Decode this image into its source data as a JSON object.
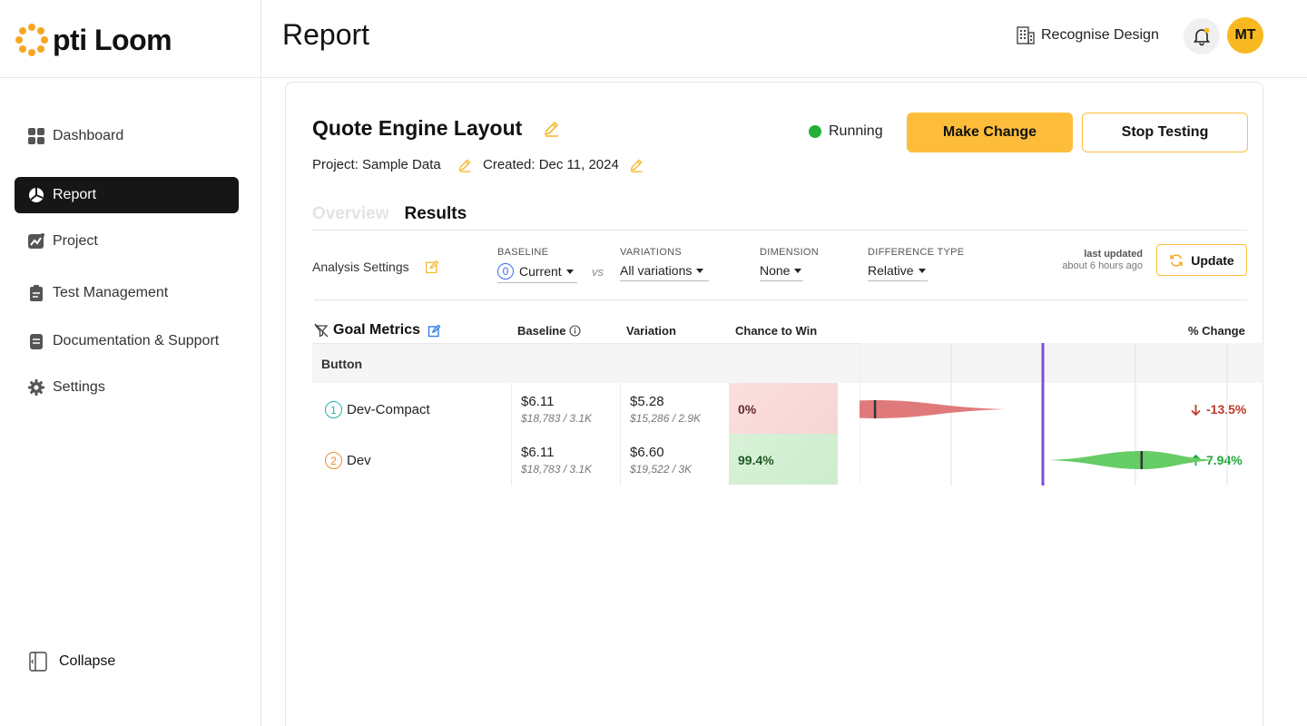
{
  "brand": {
    "name": "pti Loom",
    "accent": "#f8b81f"
  },
  "sidebar": {
    "items": [
      {
        "label": "Dashboard",
        "icon": "grid-icon",
        "active": false
      },
      {
        "label": "Report",
        "icon": "pie-chart-icon",
        "active": true
      },
      {
        "label": "Project",
        "icon": "trend-chart-icon",
        "active": false
      },
      {
        "label": "Test Management",
        "icon": "clipboard-icon",
        "active": false
      },
      {
        "label": "Documentation & Support",
        "icon": "document-icon",
        "active": false
      },
      {
        "label": "Settings",
        "icon": "gear-icon",
        "active": false
      }
    ],
    "collapse_label": "Collapse"
  },
  "header": {
    "title": "Report",
    "org_name": "Recognise Design",
    "avatar_initials": "MT"
  },
  "experiment": {
    "title": "Quote Engine Layout",
    "project": "Project: Sample Data",
    "created": "Created: Dec 11, 2024",
    "status": "Running",
    "status_color": "#22b03a",
    "make_change_label": "Make Change",
    "stop_testing_label": "Stop Testing"
  },
  "tabs": [
    {
      "label": "Overview",
      "active": false
    },
    {
      "label": "Results",
      "active": true
    }
  ],
  "analysis": {
    "label": "Analysis Settings",
    "baseline_label": "BASELINE",
    "baseline_badge": "0",
    "baseline_value": "Current",
    "vs": "vs",
    "variations_label": "VARIATIONS",
    "variations_value": "All variations",
    "dimension_label": "DIMENSION",
    "dimension_value": "None",
    "difference_label": "DIFFERENCE TYPE",
    "difference_value": "Relative",
    "last_updated_label": "last updated",
    "last_updated_value": "about 6 hours ago",
    "update_label": "Update"
  },
  "results": {
    "headers": {
      "goal_metrics": "Goal Metrics",
      "baseline": "Baseline",
      "variation": "Variation",
      "chance_to_win": "Chance to Win",
      "pct_change": "% Change"
    },
    "group": "Button",
    "rows": [
      {
        "index": "1",
        "name": "Dev-Compact",
        "badge_color": "#1bb5a8",
        "baseline": "$6.11",
        "baseline_sub": "$18,783 / 3.1K",
        "variation": "$5.28",
        "variation_sub": "$15,286 / 2.9K",
        "chance_to_win": "0%",
        "pct_change": "-13.5%",
        "direction": "down",
        "color": "#c0392b",
        "ci_low": -0.22,
        "ci_mid": -0.135,
        "ci_high": -0.03
      },
      {
        "index": "2",
        "name": "Dev",
        "badge_color": "#f08c2a",
        "baseline": "$6.11",
        "baseline_sub": "$18,783 / 3.1K",
        "variation": "$6.60",
        "variation_sub": "$19,522 / 3K",
        "chance_to_win": "99.4%",
        "pct_change": "7.94%",
        "direction": "up",
        "color": "#22a63a",
        "ci_low": 0.005,
        "ci_mid": 0.0794,
        "ci_high": 0.14
      }
    ]
  }
}
